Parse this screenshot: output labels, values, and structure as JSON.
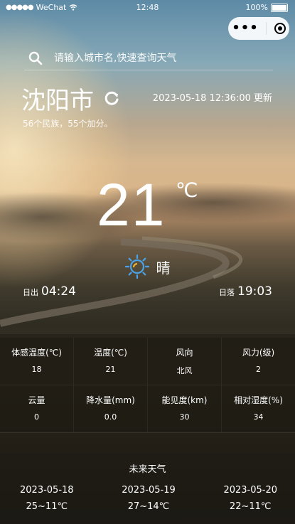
{
  "status_bar": {
    "carrier": "WeChat",
    "time": "12:48",
    "battery": "100%"
  },
  "search": {
    "placeholder": "请输入城市名,快速查询天气"
  },
  "location": {
    "city": "沈阳市",
    "updated": "2023-05-18 12:36:00 更新",
    "subtitle": "56个民族，55个加分。"
  },
  "current": {
    "temperature": "21",
    "unit": "℃",
    "condition": "晴",
    "sunrise_label": "日出",
    "sunrise_time": "04:24",
    "sunset_label": "日落",
    "sunset_time": "19:03"
  },
  "details": [
    {
      "label": "体感温度(℃)",
      "value": "18"
    },
    {
      "label": "温度(℃)",
      "value": "21"
    },
    {
      "label": "风向",
      "value": "北风"
    },
    {
      "label": "风力(级)",
      "value": "2"
    },
    {
      "label": "云量",
      "value": "0"
    },
    {
      "label": "降水量(mm)",
      "value": "0.0"
    },
    {
      "label": "能见度(km)",
      "value": "30"
    },
    {
      "label": "相对湿度(%)",
      "value": "34"
    }
  ],
  "forecast": {
    "title": "未来天气",
    "days": [
      {
        "date": "2023-05-18",
        "range": "25~11℃"
      },
      {
        "date": "2023-05-19",
        "range": "27~14℃"
      },
      {
        "date": "2023-05-20",
        "range": "22~11℃"
      }
    ]
  },
  "icons": {
    "search": "search-icon",
    "refresh": "refresh-icon",
    "weather": "sun-icon",
    "more": "more-dots-icon",
    "close": "target-icon"
  }
}
